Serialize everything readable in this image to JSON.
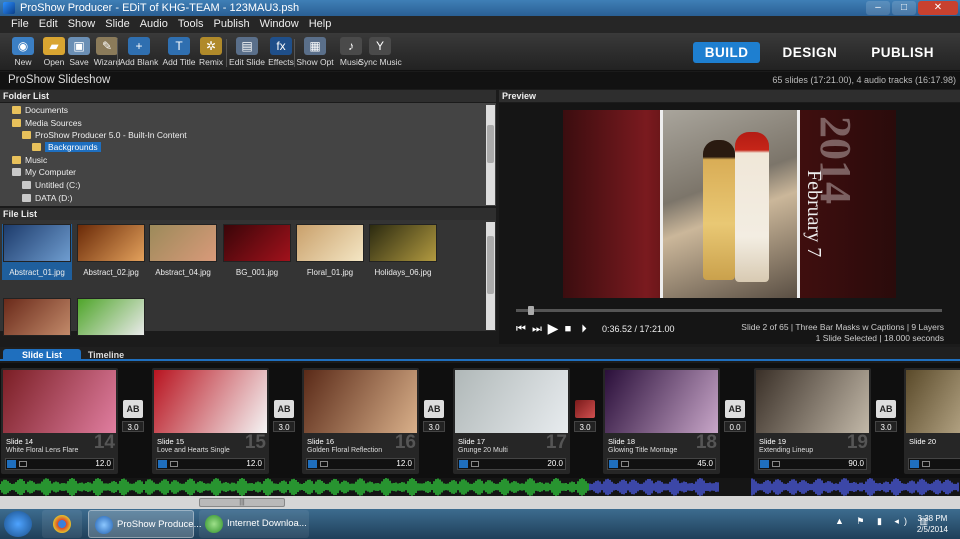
{
  "window": {
    "title": "ProShow Producer - EDiT of KHG-TEAM - 123MAU3.psh",
    "min": "–",
    "max": "□",
    "close": "✕"
  },
  "menu": [
    "File",
    "Edit",
    "Show",
    "Slide",
    "Audio",
    "Tools",
    "Publish",
    "Window",
    "Help"
  ],
  "toolbar": [
    {
      "label": "New",
      "icon": "new-icon",
      "glyph": "◉",
      "color": "#3b7fc4"
    },
    {
      "label": "Open",
      "icon": "open-folder-icon",
      "glyph": "▰",
      "color": "#d9a531"
    },
    {
      "label": "Save",
      "icon": "save-icon",
      "glyph": "▣",
      "color": "#6b8fb5"
    },
    {
      "label": "Wizard",
      "icon": "wizard-icon",
      "glyph": "✎",
      "color": "#8b7b5a"
    },
    {
      "label": "Add Blank",
      "icon": "add-blank-icon",
      "glyph": "+",
      "color": "#2f6fb0"
    },
    {
      "label": "Add Title",
      "icon": "add-title-icon",
      "glyph": "T",
      "color": "#2f6fb0"
    },
    {
      "label": "Remix",
      "icon": "remix-icon",
      "glyph": "✲",
      "color": "#b08a2a"
    },
    {
      "label": "Edit Slide",
      "icon": "edit-slide-icon",
      "glyph": "▤",
      "color": "#5a6f8a"
    },
    {
      "label": "Effects",
      "icon": "effects-icon",
      "glyph": "fx",
      "color": "#1f4f8a"
    },
    {
      "label": "Show Opt",
      "icon": "show-options-icon",
      "glyph": "▦",
      "color": "#5a6f8a"
    },
    {
      "label": "Music",
      "icon": "music-icon",
      "glyph": "♪",
      "color": "#4a4a4a"
    },
    {
      "label": "Sync Music",
      "icon": "sync-music-icon",
      "glyph": "Y",
      "color": "#4a4a4a"
    }
  ],
  "modes": [
    "BUILD",
    "DESIGN",
    "PUBLISH"
  ],
  "info": {
    "name": "ProShow Slideshow",
    "stats": "65 slides (17:21.00), 4 audio tracks (16:17.98)"
  },
  "folder_list": {
    "header": "Folder List",
    "items": [
      {
        "label": "Documents",
        "depth": 1,
        "kind": "folder"
      },
      {
        "label": "Media Sources",
        "depth": 1,
        "kind": "folder"
      },
      {
        "label": "ProShow Producer 5.0 - Built-In Content",
        "depth": 2,
        "kind": "folder"
      },
      {
        "label": "Backgrounds",
        "depth": 3,
        "kind": "folder",
        "selected": true
      },
      {
        "label": "Music",
        "depth": 1,
        "kind": "folder"
      },
      {
        "label": "My Computer",
        "depth": 1,
        "kind": "drive"
      },
      {
        "label": "Untitled (C:)",
        "depth": 2,
        "kind": "drive"
      },
      {
        "label": "DATA (D:)",
        "depth": 2,
        "kind": "drive"
      }
    ]
  },
  "file_list": {
    "header": "File List",
    "files": [
      {
        "name": "Abstract_01.jpg",
        "colors": [
          "#1d3b6b",
          "#6f9dd0"
        ],
        "selected": true
      },
      {
        "name": "Abstract_02.jpg",
        "colors": [
          "#6a2a08",
          "#e3a15c"
        ]
      },
      {
        "name": "Abstract_04.jpg",
        "colors": [
          "#9c8a5a",
          "#d99a7a"
        ]
      },
      {
        "name": "BG_001.jpg",
        "colors": [
          "#3a0508",
          "#a1121c"
        ]
      },
      {
        "name": "Floral_01.jpg",
        "colors": [
          "#c9a06b",
          "#f4e6c4"
        ]
      },
      {
        "name": "Holidays_06.jpg",
        "colors": [
          "#2b2a10",
          "#b29a40"
        ]
      },
      {
        "name": "",
        "colors": [
          "#6a2a1a",
          "#c28a6a"
        ]
      },
      {
        "name": "",
        "colors": [
          "#4fa52a",
          "#eaeaea"
        ]
      }
    ]
  },
  "preview": {
    "header": "Preview",
    "year": "2014",
    "month": "February 7",
    "time": "0:36.52 / 17:21.00",
    "info_line1": "Slide 2 of 65  |  Three Bar Masks w Captions  |  9 Layers",
    "info_line2": "1 Slide Selected  |  18.000 seconds",
    "controls": [
      "⏮",
      "⏭",
      "▶",
      "■",
      "⏵"
    ]
  },
  "tabs": [
    "Slide List",
    "Timeline"
  ],
  "slides": [
    {
      "label": "Slide 14",
      "name": "White Floral Lens Flare",
      "number": "14",
      "duration": "12.0",
      "colors": [
        "#7a1e24",
        "#e07ea0"
      ]
    },
    {
      "label": "Slide 15",
      "name": "Love and Hearts Single",
      "number": "15",
      "duration": "12.0",
      "colors": [
        "#b81420",
        "#f5f5f5"
      ]
    },
    {
      "label": "Slide 16",
      "name": "Golden Floral Reflection",
      "number": "16",
      "duration": "12.0",
      "colors": [
        "#5a2a18",
        "#d9b08a"
      ]
    },
    {
      "label": "Slide 17",
      "name": "Grunge 20 Multi",
      "number": "17",
      "duration": "20.0",
      "colors": [
        "#b0b8b8",
        "#e8ecef"
      ]
    },
    {
      "label": "Slide 18",
      "name": "Glowing Title Montage",
      "number": "18",
      "duration": "45.0",
      "colors": [
        "#2a0f3a",
        "#c8a6c8"
      ]
    },
    {
      "label": "Slide 19",
      "name": "Extending Lineup",
      "number": "19",
      "duration": "90.0",
      "colors": [
        "#3a3028",
        "#c2b8a8"
      ]
    },
    {
      "label": "Slide 20",
      "name": "",
      "number": "20",
      "duration": "",
      "colors": [
        "#5a4a2a",
        "#e8d8b8"
      ]
    }
  ],
  "transitions": [
    {
      "icon": "AB",
      "value": "3.0"
    },
    {
      "icon": "AB",
      "value": "3.0"
    },
    {
      "icon": "AB",
      "value": "3.0"
    },
    {
      "icon": "",
      "value": "3.0"
    },
    {
      "icon": "AB",
      "value": "0.0"
    },
    {
      "icon": "AB",
      "value": "3.0"
    }
  ],
  "scroll_thumb": "|||",
  "taskbar": {
    "apps": [
      {
        "label": "",
        "icon": "chrome-icon",
        "color": "#d94a2a"
      },
      {
        "label": "ProShow Produce...",
        "icon": "proshow-icon",
        "color": "#2b8fff"
      },
      {
        "label": "Internet Downloa...",
        "icon": "internet-download-manager-icon",
        "color": "#3aa33a"
      }
    ],
    "time": "3:38 PM",
    "date": "2/5/2014",
    "tray": "▲ ⚑ ▮ ◂) ▥"
  }
}
